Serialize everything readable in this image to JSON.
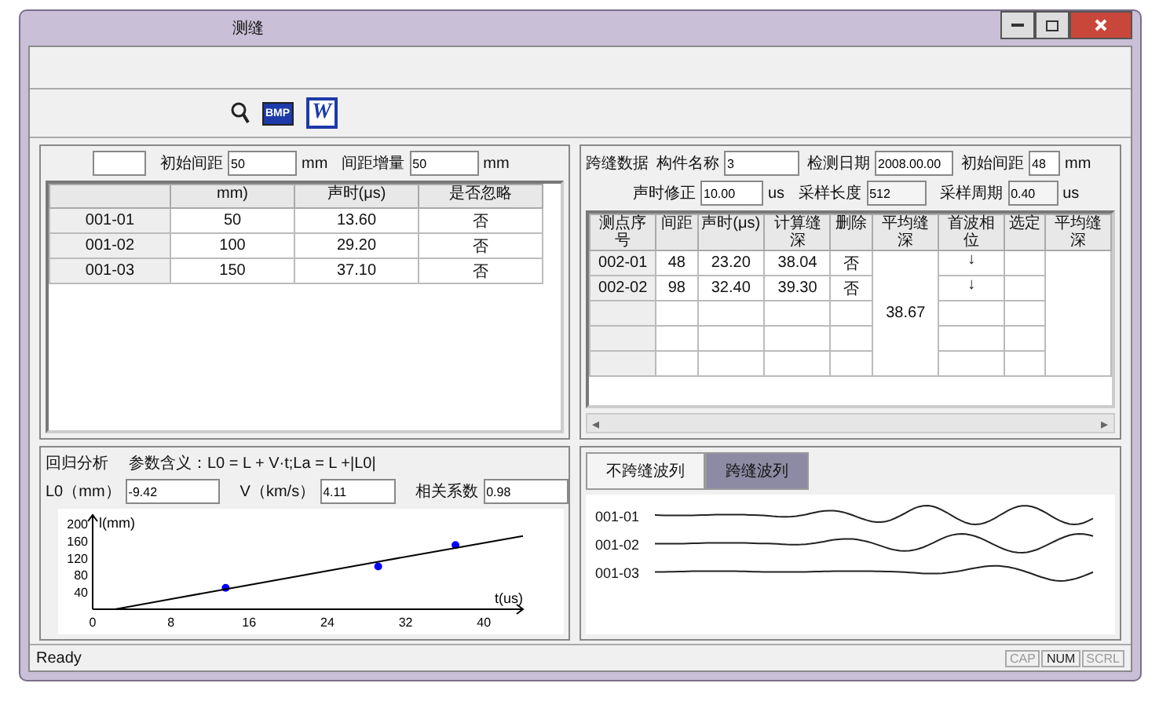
{
  "window": {
    "title": "测缝"
  },
  "toolbar": {
    "items": [
      {
        "kind": "zoom"
      },
      {
        "kind": "bmp",
        "label": "BMP"
      },
      {
        "kind": "word",
        "label": "W"
      }
    ]
  },
  "left_panel": {
    "fields": [
      {
        "label": "初始间距",
        "value": "50",
        "unit": "mm"
      },
      {
        "label": "间距增量",
        "value": "50",
        "unit": "mm"
      }
    ],
    "table": {
      "columns": [
        "",
        "mm)",
        "声时(μs)",
        "是否忽略"
      ],
      "rows": [
        {
          "cells": [
            "001-01",
            "50",
            "13.60",
            "否"
          ]
        },
        {
          "cells": [
            "001-02",
            "100",
            "29.20",
            "否"
          ]
        },
        {
          "cells": [
            "001-03",
            "150",
            "37.10",
            "否"
          ]
        }
      ]
    }
  },
  "right_panel": {
    "title": "跨缝数据",
    "fields": [
      {
        "label": "构件名称",
        "value": "3"
      },
      {
        "label": "检测日期",
        "value": "2008.00.00"
      },
      {
        "label": "初始间距",
        "value": "48",
        "unit": "mm"
      },
      {
        "label": "声时修正",
        "value": "10.00",
        "unit": "us"
      },
      {
        "label": "采样长度",
        "value": "512"
      },
      {
        "label": "采样周期",
        "value": "0.40",
        "unit": "us"
      }
    ],
    "table": {
      "columns": [
        "测点序号",
        "间距",
        "声时(μs)",
        "计算缝深",
        "删除",
        "平均缝深",
        "首波相位",
        "选定",
        "平均缝深"
      ],
      "rows": [
        {
          "cells": [
            "002-01",
            "48",
            "23.20",
            "38.04",
            "否"
          ],
          "phase": "↓"
        },
        {
          "cells": [
            "002-02",
            "98",
            "32.40",
            "39.30",
            "否"
          ],
          "phase": "↓"
        }
      ],
      "average": "38.67"
    },
    "scroll_arrows": [
      "◂",
      "▸"
    ]
  },
  "regression": {
    "title": "回归分析",
    "meaning": "参数含义：L0 = L + V·t;La = L +|L0|",
    "fields": [
      {
        "label": "L0（mm）",
        "value": "-9.42"
      },
      {
        "label": "V（km/s）",
        "value": "4.11"
      },
      {
        "label": "相关系数",
        "value": "0.98"
      }
    ],
    "chart_data": {
      "type": "scatter",
      "xlabel": "t(us)",
      "ylabel": "l(mm)",
      "x": [
        2.29,
        13.6,
        29.2,
        37.1,
        44
      ],
      "series": [
        {
          "type": "scatter",
          "color": "#0000ff",
          "values": [
            null,
            50,
            100,
            150,
            null
          ]
        },
        {
          "type": "line",
          "color": "#000000",
          "values": [
            0,
            47,
            111,
            143,
            171
          ]
        }
      ],
      "xlim": [
        0,
        44
      ],
      "ylim": [
        0,
        220
      ],
      "xticks": [
        0,
        8,
        16,
        24,
        32,
        40
      ],
      "yticks": [
        40,
        80,
        120,
        160,
        200
      ]
    }
  },
  "waves": {
    "tabs": [
      {
        "label": "不跨缝波列",
        "selected": false
      },
      {
        "label": "跨缝波列",
        "selected": true
      }
    ],
    "traces": [
      "001-01",
      "001-02",
      "001-03"
    ]
  },
  "status_bar": {
    "text": "Ready",
    "indicators": [
      {
        "label": "CAP",
        "on": false
      },
      {
        "label": "NUM",
        "on": true
      },
      {
        "label": "SCRL",
        "on": false
      }
    ]
  }
}
